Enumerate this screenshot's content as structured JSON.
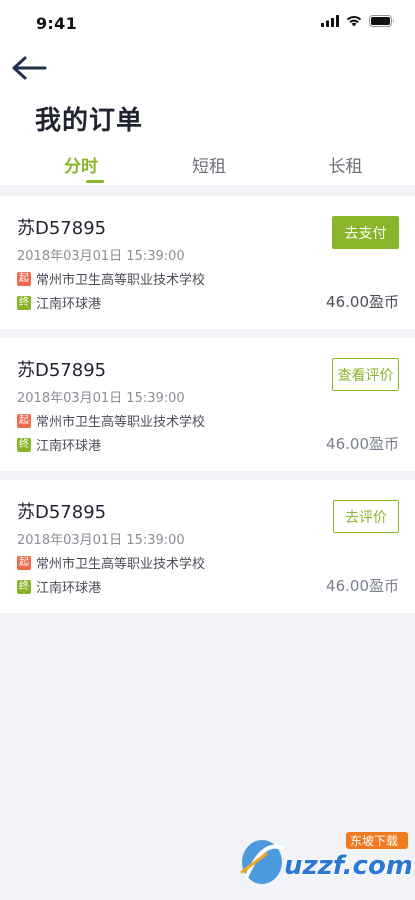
{
  "status_bar": {
    "time": "9:41"
  },
  "header": {
    "title": "我的订单"
  },
  "tabs": [
    {
      "label": "分时",
      "active": true
    },
    {
      "label": "短租",
      "active": false
    },
    {
      "label": "长租",
      "active": false
    }
  ],
  "orders": [
    {
      "plate": "苏D57895",
      "datetime": "2018年03月01日 15:39:00",
      "start_badge": "起",
      "start": "常州市卫生高等职业技术学校",
      "end_badge": "终",
      "end": "江南环球港",
      "price": "46.00盈币",
      "action": "去支付"
    },
    {
      "plate": "苏D57895",
      "datetime": "2018年03月01日 15:39:00",
      "start_badge": "起",
      "start": "常州市卫生高等职业技术学校",
      "end_badge": "终",
      "end": "江南环球港",
      "price": "46.00盈币",
      "action": "查看评价"
    },
    {
      "plate": "苏D57895",
      "datetime": "2018年03月01日 15:39:00",
      "start_badge": "起",
      "start": "常州市卫生高等职业技术学校",
      "end_badge": "终",
      "end": "江南环球港",
      "price": "46.00盈币",
      "action": "去评价"
    }
  ],
  "watermark": {
    "brand": "uzzf.com",
    "tag": "东坡下载"
  },
  "colors": {
    "accent": "#8ab52a",
    "start_badge": "#ef6a4b",
    "background": "#f2f3f7"
  },
  "icons": [
    "back-arrow-icon",
    "signal-icon",
    "wifi-icon",
    "battery-icon"
  ]
}
